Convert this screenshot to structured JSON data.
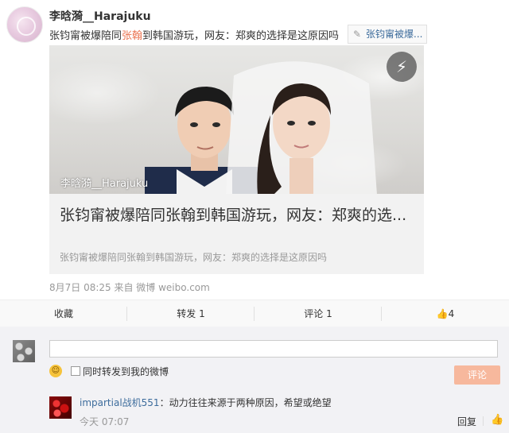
{
  "post": {
    "username": "李晗漪__Harajuku",
    "text_before": "张钧甯被爆陪同",
    "text_highlight": "张翰",
    "text_after": "到韩国游玩，网友：郑爽的选择是这原因吗",
    "topic_tag": "张钧甯被爆...",
    "meta": "8月7日 08:25 来自 微博 weibo.com"
  },
  "card": {
    "watermark": "李晗漪__Harajuku",
    "title": "张钧甯被爆陪同张翰到韩国游玩，网友：郑爽的选...",
    "subtitle": "张钧甯被爆陪同张翰到韩国游玩，网友：郑爽的选择是这原因吗",
    "icon": "lightning-icon"
  },
  "actions": {
    "favorite": "收藏",
    "repost": "转发 1",
    "comment": "评论 1",
    "like_count": "4"
  },
  "comment_box": {
    "placeholder": "",
    "checkbox_label": "同时转发到我的微博",
    "submit": "评论"
  },
  "comments": [
    {
      "user": "impartial战机551",
      "text": "：动力往往来源于两种原因，希望或绝望",
      "time": "今天 07:07",
      "reply": "回复"
    }
  ],
  "colors": {
    "link": "#3d6c9c",
    "highlight": "#eb7350",
    "button": "#f7b89d"
  }
}
